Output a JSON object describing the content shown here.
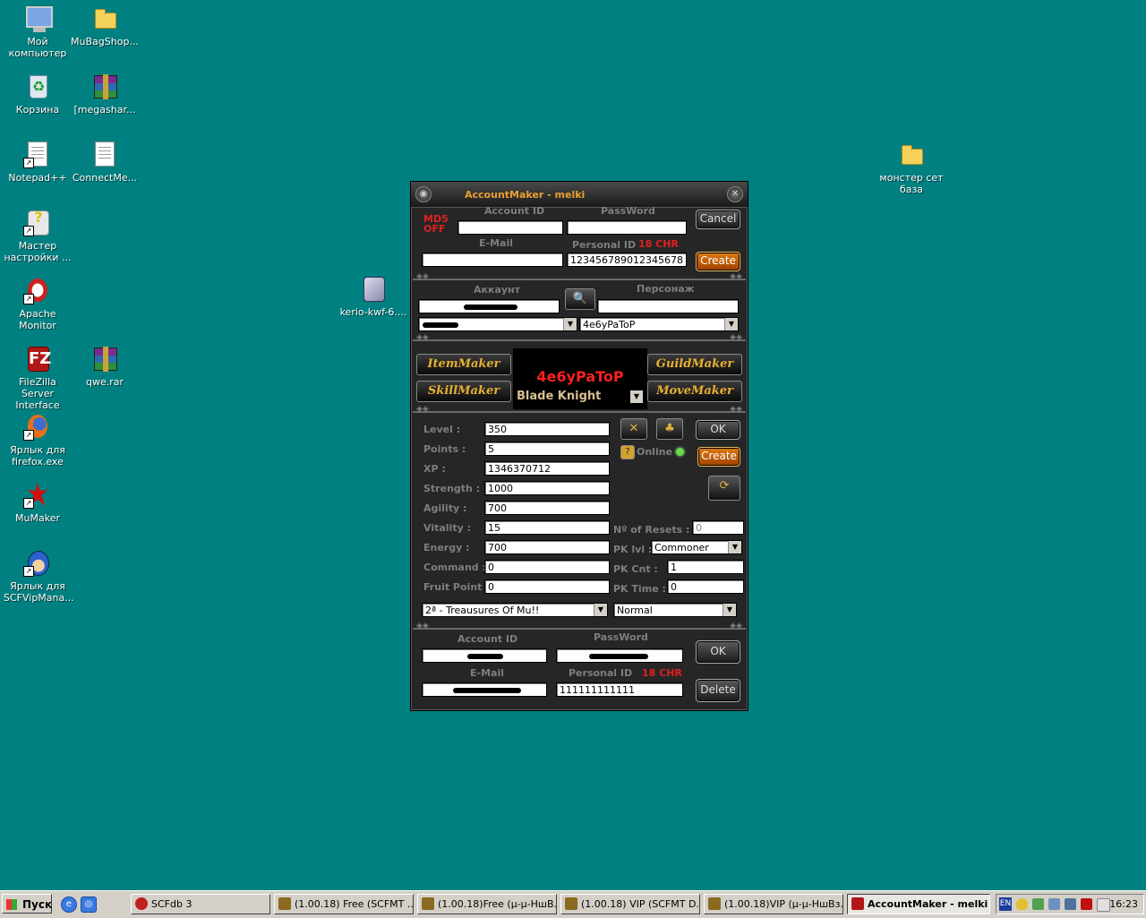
{
  "desktop": {
    "icons": [
      {
        "label": "Мой компьютер"
      },
      {
        "label": "MuBagShop..."
      },
      {
        "label": "Корзина"
      },
      {
        "label": "[megashar..."
      },
      {
        "label": "Notepad++"
      },
      {
        "label": "ConnectMe..."
      },
      {
        "label": "Мастер настройки ..."
      },
      {
        "label": "Apache Monitor"
      },
      {
        "label": "kerio-kwf-6...."
      },
      {
        "label": "FileZilla Server Interface"
      },
      {
        "label": "qwe.rar"
      },
      {
        "label": "Ярлык для firefox.exe"
      },
      {
        "label": "MuMaker"
      },
      {
        "label": "Ярлык для SCFVipMana..."
      },
      {
        "label": "монстер сет база"
      }
    ]
  },
  "window": {
    "title": "AccountMaker - melki",
    "account": {
      "md5_line1": "MD5",
      "md5_line2": "OFF",
      "account_id_label": "Account ID",
      "password_label": "PassWord",
      "email_label": "E-Mail",
      "personal_id_label": "Personal ID",
      "chr_label": "18 CHR",
      "account_id_value": "",
      "password_value": "",
      "email_value": "",
      "personal_id_value": "123456789012345678",
      "cancel_label": "Cancel",
      "create_label": "Create"
    },
    "search": {
      "account_label": "Аккаунт",
      "character_label": "Персонаж",
      "character_select_value": "4e6yPaToP"
    },
    "makers": {
      "item": "ItemMaker",
      "skill": "SkillMaker",
      "guild": "GuildMaker",
      "move": "MoveMaker"
    },
    "character": {
      "name": "4e6yPaToP",
      "class": "Blade Knight"
    },
    "stats": {
      "level_label": "Level :",
      "level": "350",
      "points_label": "Points :",
      "points": "5",
      "xp_label": "XP :",
      "xp": "1346370712",
      "strength_label": "Strength :",
      "strength": "1000",
      "agility_label": "Agility :",
      "agility": "700",
      "vitality_label": "Vitality :",
      "vitality": "15",
      "energy_label": "Energy :",
      "energy": "700",
      "command_label": "Command :",
      "command": "0",
      "fruit_label": "Fruit Point :",
      "fruit": "0"
    },
    "side": {
      "ok_label": "OK",
      "create_label": "Create",
      "online_label": "Online",
      "online_help": "?",
      "resets_label": "Nº of Resets :",
      "resets_value": "0",
      "pk_lvl_label": "PK lvl :",
      "pk_lvl_value": "Commoner",
      "pk_cnt_label": "PK Cnt :",
      "pk_cnt_value": "1",
      "pk_time_label": "PK Time :",
      "pk_time_value": "0"
    },
    "dropdowns": {
      "server_value": "2ª - Treausures Of Mu!!",
      "mode_value": "Normal"
    },
    "bottom": {
      "account_id_label": "Account ID",
      "password_label": "PassWord",
      "email_label": "E-Mail",
      "personal_id_label": "Personal ID",
      "chr_label": "18 CHR",
      "personal_id_value": "111111111111",
      "ok_label": "OK",
      "delete_label": "Delete"
    },
    "colors": {
      "title": "#e8a030",
      "warning": "#e02020",
      "online": "#66dd44",
      "char_name": "#ff2020"
    }
  },
  "taskbar": {
    "start_label": "Пуск",
    "buttons": [
      {
        "label": "SCFdb 3"
      },
      {
        "label": "(1.00.18) Free (SCFMT ..."
      },
      {
        "label": "(1.00.18)Free (µ-µ-НшВ..."
      },
      {
        "label": "(1.00.18) VIP (SCFMT D..."
      },
      {
        "label": "(1.00.18)VIP (µ-µ-НшВз..."
      },
      {
        "label": "AccountMaker - melki"
      }
    ],
    "lang": "EN",
    "clock": "16:23"
  }
}
